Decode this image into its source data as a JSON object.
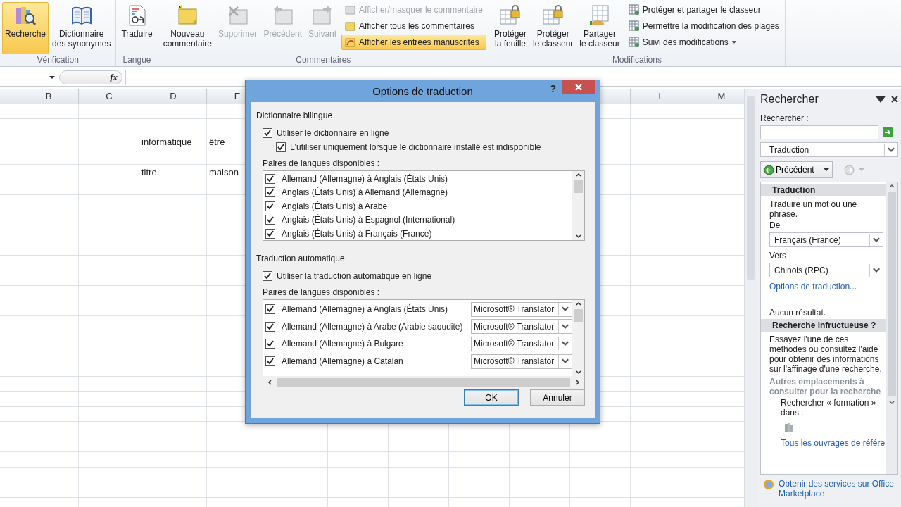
{
  "ribbon": {
    "groups": [
      {
        "label": "Vérification",
        "large_buttons": [
          {
            "label": "Recherche",
            "selected": true,
            "disabled": false
          },
          {
            "label": "Dictionnaire\ndes synonymes",
            "selected": false,
            "disabled": false
          }
        ]
      },
      {
        "label": "Langue",
        "large_buttons": [
          {
            "label": "Traduire",
            "selected": false,
            "disabled": false
          }
        ]
      },
      {
        "label": "Commentaires",
        "large_buttons": [
          {
            "label": "Nouveau\ncommentaire",
            "selected": false,
            "disabled": false
          },
          {
            "label": "Supprimer",
            "selected": false,
            "disabled": true
          },
          {
            "label": "Précédent",
            "selected": false,
            "disabled": true
          },
          {
            "label": "Suivant",
            "selected": false,
            "disabled": true
          }
        ],
        "small_buttons": [
          {
            "label": "Afficher/masquer le commentaire",
            "selected": false,
            "disabled": true,
            "dropdown": false
          },
          {
            "label": "Afficher tous les commentaires",
            "selected": false,
            "disabled": false,
            "dropdown": false
          },
          {
            "label": "Afficher les entrées manuscrites",
            "selected": true,
            "disabled": false,
            "dropdown": false
          }
        ]
      },
      {
        "label": "Modifications",
        "large_buttons": [
          {
            "label": "Protéger\nla feuille",
            "selected": false,
            "disabled": false
          },
          {
            "label": "Protéger\nle classeur",
            "selected": false,
            "disabled": false
          },
          {
            "label": "Partager\nle classeur",
            "selected": false,
            "disabled": false
          }
        ],
        "small_buttons": [
          {
            "label": "Protéger et partager le classeur",
            "selected": false,
            "disabled": false,
            "dropdown": false
          },
          {
            "label": "Permettre la modification des plages",
            "selected": false,
            "disabled": false,
            "dropdown": false
          },
          {
            "label": "Suivi des modifications",
            "selected": false,
            "disabled": false,
            "dropdown": true
          }
        ]
      }
    ]
  },
  "formula_bar": {
    "function_label": "fx"
  },
  "sheet": {
    "column_headers": [
      "B",
      "C",
      "D",
      "E",
      "L",
      "M"
    ],
    "rows": [
      {
        "cells": [
          "informatique",
          "être"
        ]
      },
      {
        "cells": [
          "titre",
          "maison"
        ]
      }
    ]
  },
  "dialog": {
    "title": "Options de traduction",
    "help": "?",
    "bilingual": {
      "heading": "Dictionnaire bilingue",
      "options": [
        {
          "label": "Utiliser le dictionnaire en ligne",
          "checked": true,
          "nested": false
        },
        {
          "label": "L'utiliser uniquement lorsque le dictionnaire installé est indisponible",
          "checked": true,
          "nested": true
        }
      ],
      "pairs_label": "Paires de langues disponibles :",
      "pairs": [
        {
          "label": "Allemand (Allemagne) à Anglais (États Unis)",
          "checked": true
        },
        {
          "label": "Anglais (États Unis) à Allemand (Allemagne)",
          "checked": true
        },
        {
          "label": "Anglais (États Unis) à Arabe",
          "checked": true
        },
        {
          "label": "Anglais (États Unis) à Espagnol (International)",
          "checked": true
        },
        {
          "label": "Anglais (États Unis) à Français (France)",
          "checked": true
        }
      ]
    },
    "automatic": {
      "heading": "Traduction automatique",
      "options": [
        {
          "label": "Utiliser la traduction automatique en ligne",
          "checked": true,
          "nested": false
        }
      ],
      "pairs_label": "Paires de langues disponibles :",
      "pairs": [
        {
          "label": "Allemand (Allemagne) à Anglais (États Unis)",
          "checked": true,
          "service": "Microsoft® Translator"
        },
        {
          "label": "Allemand (Allemagne) à Arabe (Arabie saoudite)",
          "checked": true,
          "service": "Microsoft® Translator"
        },
        {
          "label": "Allemand (Allemagne) à Bulgare",
          "checked": true,
          "service": "Microsoft® Translator"
        },
        {
          "label": "Allemand (Allemagne) à Catalan",
          "checked": true,
          "service": "Microsoft® Translator"
        }
      ]
    },
    "buttons": [
      {
        "label": "OK",
        "default": true
      },
      {
        "label": "Annuler",
        "default": false
      }
    ]
  },
  "research_pane": {
    "title": "Rechercher",
    "search_label": "Rechercher :",
    "source": "Traduction",
    "back_label": "Précédent",
    "section_title": "Traduction",
    "intro": "Traduire un mot ou une phrase.",
    "from_label": "De",
    "from_value": "Français (France)",
    "to_label": "Vers",
    "to_value": "Chinois (RPC)",
    "options_link": "Options de traduction...",
    "no_result": "Aucun résultat.",
    "help_title": "Recherche infructueuse ?",
    "help_text": "Essayez l'une de ces méthodes ou consultez l'aide pour obtenir des informations sur l'affinage d'une recherche.",
    "other_places": "Autres emplacements à consulter pour la recherche",
    "search_in": "Rechercher « formation » dans :",
    "reference_link": "Tous les ouvrages de référe",
    "marketplace_link": "Obtenir des services sur Office Marketplace"
  }
}
